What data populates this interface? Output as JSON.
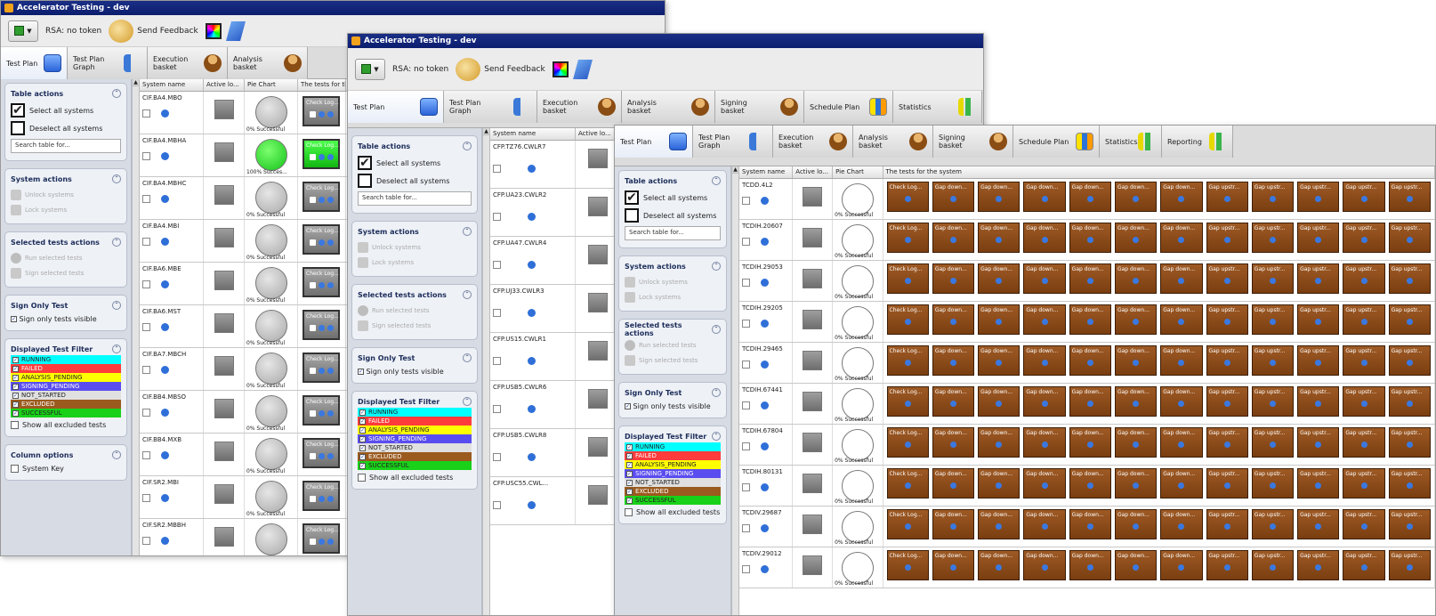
{
  "win1": {
    "title": "Accelerator Testing - dev",
    "rsa": "RSA: no token",
    "feedback": "Send Feedback",
    "tabs": [
      {
        "line1": "Test Plan",
        "line2": "",
        "icon": "book"
      },
      {
        "line1": "Test Plan",
        "line2": "Graph",
        "icon": "graph"
      },
      {
        "line1": "Execution",
        "line2": "basket",
        "icon": "person"
      },
      {
        "line1": "Analysis",
        "line2": "basket",
        "icon": "person"
      }
    ],
    "sidebar": {
      "table_actions": "Table actions",
      "select_all": "Select all systems",
      "deselect_all": "Deselect all systems",
      "search_placeholder": "Search table for...",
      "system_actions": "System actions",
      "unlock": "Unlock systems",
      "lock": "Lock systems",
      "selected_tests": "Selected tests actions",
      "run_selected": "Run selected tests",
      "sign_selected": "Sign selected tests",
      "sign_only": "Sign Only Test",
      "sign_only_visible": "Sign only tests visible",
      "filter": "Displayed Test Filter",
      "show_excluded": "Show all excluded tests",
      "column_options": "Column options",
      "system_key": "System Key"
    },
    "headers": [
      "System name",
      "Active lo...",
      "Pie Chart",
      "The tests for th"
    ],
    "rows": [
      {
        "name": "CIF.BA4.MBO",
        "pie": "0% Successful",
        "state": "gray"
      },
      {
        "name": "CIF.BA4.MBHA",
        "pie": "100% Succes...",
        "state": "green"
      },
      {
        "name": "CIF.BA4.MBHC",
        "pie": "0% Successful",
        "state": "gray"
      },
      {
        "name": "CIF.BA4.MBI",
        "pie": "0% Successful",
        "state": "gray"
      },
      {
        "name": "CIF.BA6.MBE",
        "pie": "0% Successful",
        "state": "gray"
      },
      {
        "name": "CIF.BA6.MST",
        "pie": "0% Successful",
        "state": "gray"
      },
      {
        "name": "CIF.BA7.MBCH",
        "pie": "0% Successful",
        "state": "gray"
      },
      {
        "name": "CIF.BB4.MBSO",
        "pie": "0% Successful",
        "state": "gray"
      },
      {
        "name": "CIF.BB4.MXB",
        "pie": "0% Successful",
        "state": "gray"
      },
      {
        "name": "CIF.SR2.MBI",
        "pie": "0% Successful",
        "state": "gray"
      },
      {
        "name": "CIF.SR2.MBBH",
        "pie": "",
        "state": "gray"
      }
    ],
    "check_label": "Check Log..."
  },
  "win2": {
    "title": "Accelerator Testing - dev",
    "rsa": "RSA: no token",
    "feedback": "Send Feedback",
    "tabs": [
      {
        "line1": "Test Plan",
        "line2": "",
        "icon": "book"
      },
      {
        "line1": "Test Plan",
        "line2": "Graph",
        "icon": "graph"
      },
      {
        "line1": "Execution",
        "line2": "basket",
        "icon": "person"
      },
      {
        "line1": "Analysis",
        "line2": "basket",
        "icon": "person"
      },
      {
        "line1": "Signing",
        "line2": "basket",
        "icon": "person"
      },
      {
        "line1": "Schedule Plan",
        "line2": "",
        "icon": "chart"
      },
      {
        "line1": "Statistics",
        "line2": "",
        "icon": "bars"
      }
    ],
    "headers": [
      "System name",
      "Active lo..."
    ],
    "rows": [
      "CFP.TZ76.CWLR7",
      "CFP.UA23.CWLR2",
      "CFP.UA47.CWLR4",
      "CFP.UJ33.CWLR3",
      "CFP.US15.CWLR1",
      "CFP.USB5.CWLR6",
      "CFP.USB5.CWLR8",
      "CFP.USC55.CWL..."
    ]
  },
  "win3": {
    "tabs": [
      {
        "line1": "Test Plan",
        "line2": "",
        "icon": "book"
      },
      {
        "line1": "Test Plan",
        "line2": "Graph",
        "icon": "graph"
      },
      {
        "line1": "Execution",
        "line2": "basket",
        "icon": "person"
      },
      {
        "line1": "Analysis",
        "line2": "basket",
        "icon": "person"
      },
      {
        "line1": "Signing",
        "line2": "basket",
        "icon": "person"
      },
      {
        "line1": "Schedule Plan",
        "line2": "",
        "icon": "chart"
      },
      {
        "line1": "Statistics",
        "line2": "",
        "icon": "bars"
      },
      {
        "line1": "Reporting",
        "line2": "",
        "icon": "bars"
      }
    ],
    "headers": [
      "System name",
      "Active lo...",
      "Pie Chart",
      "The tests for the system"
    ],
    "rows": [
      "TCDD.4L2",
      "TCDIH.20607",
      "TCDIH.29053",
      "TCDIH.29205",
      "TCDIH.29465",
      "TCDIH.67441",
      "TCDIH.67804",
      "TCDIH.80131",
      "TCDIV.29687",
      "TCDIV.29012"
    ],
    "pie_label": "0% Successful",
    "test_labels": [
      "Check Log...",
      "Gap down...",
      "Gap down...",
      "Gap down...",
      "Gap down...",
      "Gap down...",
      "Gap down...",
      "Gap upstr...",
      "Gap upstr...",
      "Gap upstr...",
      "Gap upstr...",
      "Gap upstr..."
    ]
  },
  "filters": [
    {
      "label": "RUNNING",
      "color": "#00ffff"
    },
    {
      "label": "FAILED",
      "color": "#ff3b3b"
    },
    {
      "label": "ANALYSIS_PENDING",
      "color": "#ffff00"
    },
    {
      "label": "SIGNING_PENDING",
      "color": "#5a4df0"
    },
    {
      "label": "NOT_STARTED",
      "color": "#e0e0e0"
    },
    {
      "label": "EXCLUDED",
      "color": "#9b5a1e"
    },
    {
      "label": "SUCCESSFUL",
      "color": "#19d119"
    }
  ]
}
